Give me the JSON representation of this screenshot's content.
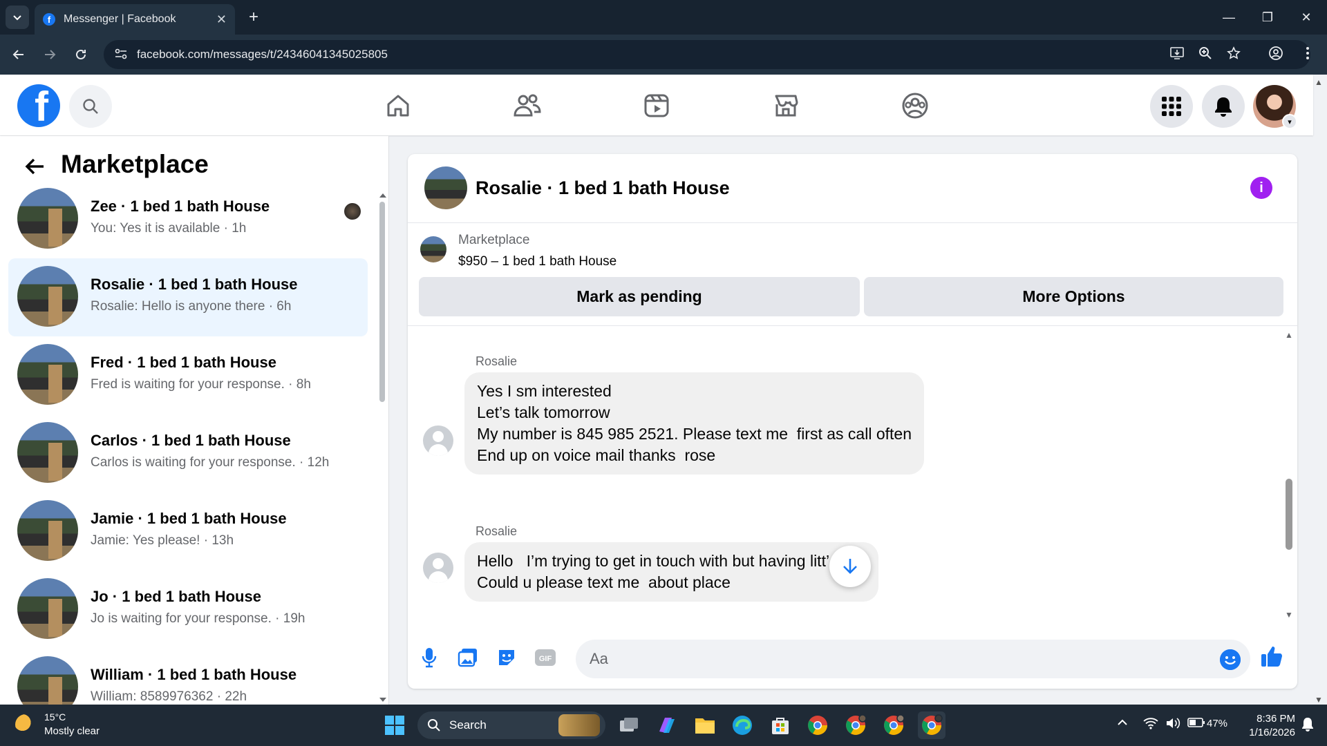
{
  "browser": {
    "tab_title": "Messenger | Facebook",
    "url": "facebook.com/messages/t/24346041345025805"
  },
  "fb_header": {
    "nav_items": [
      "home-icon",
      "friends-icon",
      "watch-icon",
      "marketplace-icon",
      "groups-icon"
    ]
  },
  "sidebar": {
    "title": "Marketplace",
    "conversations": [
      {
        "name": "Zee · 1 bed 1 bath House",
        "preview": "You: Yes it is available · 1h",
        "active": false
      },
      {
        "name": "Rosalie · 1 bed 1 bath House",
        "preview": "Rosalie: Hello is anyone there · 6h",
        "active": true
      },
      {
        "name": "Fred · 1 bed 1 bath House",
        "preview": "Fred is waiting for your response. · 8h",
        "active": false
      },
      {
        "name": "Carlos · 1 bed 1 bath House",
        "preview": "Carlos is waiting for your response. · 12h",
        "active": false
      },
      {
        "name": "Jamie · 1 bed 1 bath House",
        "preview": "Jamie: Yes please! · 13h",
        "active": false
      },
      {
        "name": "Jo · 1 bed 1 bath House",
        "preview": "Jo is waiting for your response. · 19h",
        "active": false
      },
      {
        "name": "William · 1 bed 1 bath House",
        "preview": "William: 8589976362 · 22h",
        "active": false
      }
    ]
  },
  "chat": {
    "title": "Rosalie · 1 bed 1 bath House",
    "marketplace_label": "Marketplace",
    "listing": "$950 – 1 bed 1 bath House",
    "mark_pending_label": "Mark as pending",
    "more_options_label": "More Options",
    "messages": [
      {
        "sender": "Rosalie",
        "text": "Yes I sm interested\nLet’s talk tomorrow\nMy number is 845 985 2521. Please text me  first as call often\nEnd up on voice mail thanks  rose"
      },
      {
        "sender": "Rosalie",
        "text": "Hello   I’m trying to get in touch with but having litt’  luck\nCould u please text me  about place"
      }
    ],
    "compose_placeholder": "Aa",
    "accent_color": "#1877f2"
  },
  "taskbar": {
    "temperature": "15°C",
    "weather": "Mostly clear",
    "search_label": "Search",
    "battery": "47%",
    "time": "8:36 PM",
    "date": "1/16/2026"
  }
}
